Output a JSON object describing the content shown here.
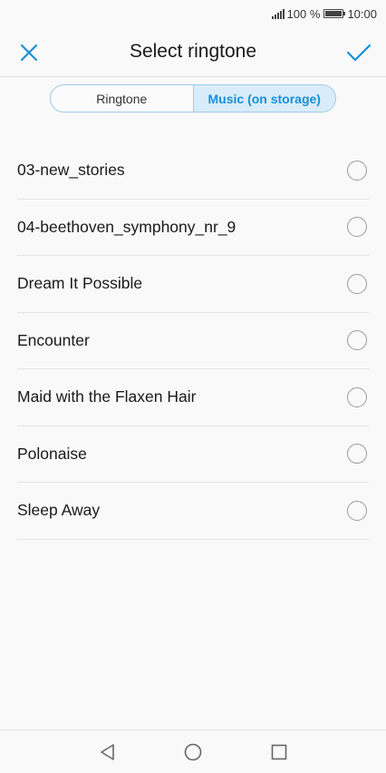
{
  "status_bar": {
    "battery_percent": "100 %",
    "time": "10:00"
  },
  "header": {
    "title": "Select ringtone",
    "close_icon": "close-icon",
    "confirm_icon": "checkmark-icon"
  },
  "tabs": {
    "ringtone_label": "Ringtone",
    "music_label": "Music (on storage)",
    "active": "music"
  },
  "songs": [
    {
      "label": "03-new_stories"
    },
    {
      "label": "04-beethoven_symphony_nr_9"
    },
    {
      "label": "Dream It Possible"
    },
    {
      "label": "Encounter"
    },
    {
      "label": "Maid with the Flaxen Hair"
    },
    {
      "label": "Polonaise"
    },
    {
      "label": "Sleep Away"
    }
  ],
  "nav": {
    "back_icon": "back-triangle-icon",
    "home_icon": "home-circle-icon",
    "recents_icon": "recents-square-icon"
  },
  "colors": {
    "accent": "#1a8fd9",
    "tab_active_bg": "#d9ecf9"
  }
}
